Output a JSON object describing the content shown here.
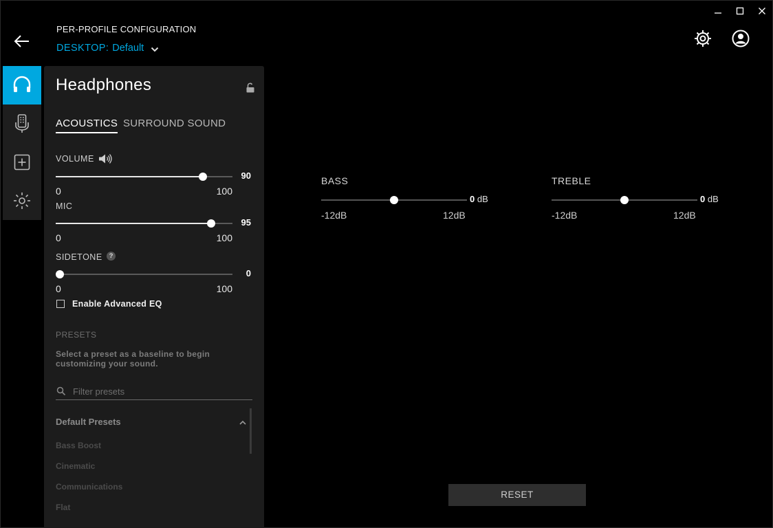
{
  "header": {
    "title": "PER-PROFILE CONFIGURATION",
    "profile_label": "DESKTOP:",
    "profile_value": "Default"
  },
  "panel": {
    "title": "Headphones",
    "tabs": [
      {
        "label": "ACOUSTICS",
        "active": true
      },
      {
        "label": "SURROUND SOUND",
        "active": false
      }
    ],
    "sliders": [
      {
        "label": "VOLUME",
        "value": 90,
        "min": "0",
        "max": "100"
      },
      {
        "label": "MIC",
        "value": 95,
        "min": "0",
        "max": "100"
      },
      {
        "label": "SIDETONE",
        "value": 0,
        "min": "0",
        "max": "100"
      }
    ],
    "advanced_eq": {
      "label": "Enable Advanced EQ",
      "checked": false
    },
    "presets": {
      "heading": "PRESETS",
      "description": "Select a preset as a baseline to begin customizing your sound.",
      "filter_placeholder": "Filter presets",
      "group": "Default Presets",
      "items": [
        "Bass Boost",
        "Cinematic",
        "Communications",
        "Flat"
      ]
    }
  },
  "eq": {
    "bass": {
      "label": "BASS",
      "value": "0",
      "unit": "dB",
      "min": "-12dB",
      "max": "12dB"
    },
    "treble": {
      "label": "TREBLE",
      "value": "0",
      "unit": "dB",
      "min": "-12dB",
      "max": "12dB"
    }
  },
  "reset_label": "RESET",
  "colors": {
    "accent": "#00a8e0",
    "background": "#000000",
    "panel": "#1c1c1c",
    "rail": "#1e1e1e"
  },
  "icons": [
    "minimize-icon",
    "maximize-icon",
    "close-icon",
    "back-arrow-icon",
    "chevron-down-icon",
    "gear-icon",
    "account-icon",
    "headphones-icon",
    "microphone-icon",
    "add-icon",
    "lighting-icon",
    "lock-icon",
    "speaker-icon",
    "help-icon",
    "search-icon",
    "chevron-up-icon"
  ]
}
